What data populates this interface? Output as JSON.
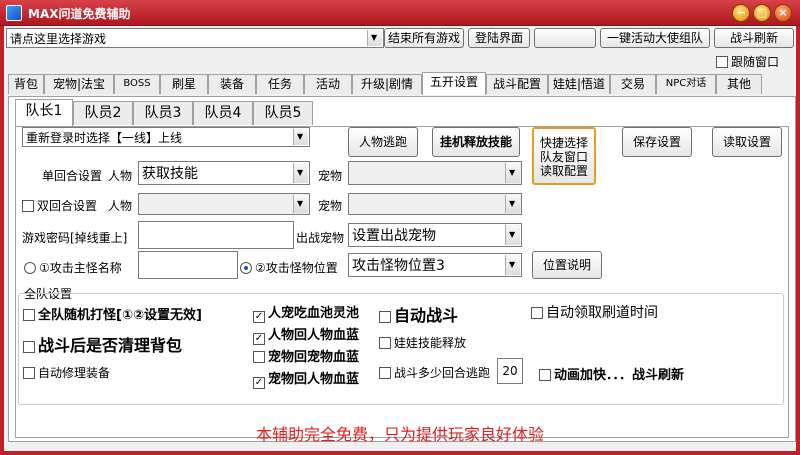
{
  "window": {
    "title": "MAX问道免费辅助",
    "min": "−",
    "max": "□",
    "close": "×"
  },
  "toolbar": {
    "game_select": "请点这里选择游戏",
    "end_all": "结束所有游戏",
    "login_ui": "登陆界面",
    "blank": "",
    "team_envoy": "一键活动大使组队",
    "battle_refresh": "战斗刷新",
    "follow_window": "跟随窗口"
  },
  "tabs": [
    "背包",
    "宠物|法宝",
    "BOSS",
    "刷星",
    "装备",
    "任务",
    "活动",
    "升级|剧情",
    "五开设置",
    "战斗配置",
    "娃娃|悟道",
    "交易",
    "NPC对话",
    "其他"
  ],
  "active_tab": "五开设置",
  "subtabs": [
    "队长1",
    "队员2",
    "队员3",
    "队员4",
    "队员5"
  ],
  "settings": {
    "relogin_combo": "重新登录时选择【一线】上线",
    "escape_btn": "人物逃跑",
    "hangup_btn": "挂机释放技能",
    "quick_select": "快捷选择\n队友窗口\n读取配置",
    "save_btn": "保存设置",
    "load_btn": "读取设置",
    "single_round_label": "单回合设置",
    "char_label": "人物",
    "char_combo": "获取技能",
    "pet_label": "宠物",
    "pet_combo": "",
    "double_round": "双回合设置",
    "char_label2": "人物",
    "char_combo2": "",
    "pet_label2": "宠物",
    "pet_combo2": "",
    "password_label": "游戏密码[掉线重上]",
    "password_value": "",
    "out_pet_label": "出战宠物",
    "out_pet_combo": "设置出战宠物",
    "attack_name_radio": "①攻击主怪名称",
    "attack_name_value": "",
    "attack_pos_radio": "②攻击怪物位置",
    "attack_pos_combo": "攻击怪物位置3",
    "pos_help_btn": "位置说明"
  },
  "team": {
    "group_label": "全队设置",
    "random_attack": "全队随机打怪[①②设置无效]",
    "clear_bag": "战斗后是否清理背包",
    "auto_repair": "自动修理装备",
    "human_pet_hp": "人宠吃血池灵池",
    "human_hp": "人物回人物血蓝",
    "pet_hp": "宠物回宠物血蓝",
    "pet_human_hp": "宠物回人物血蓝",
    "auto_battle": "自动战斗",
    "doll_skill": "娃娃技能释放",
    "escape_rounds": "战斗多少回合逃跑",
    "escape_rounds_value": "20",
    "auto_collect": "自动领取刷道时间",
    "anim_speed": "动画加快．．．战斗刷新"
  },
  "footer": "本辅助完全免费，只为提供玩家良好体验"
}
